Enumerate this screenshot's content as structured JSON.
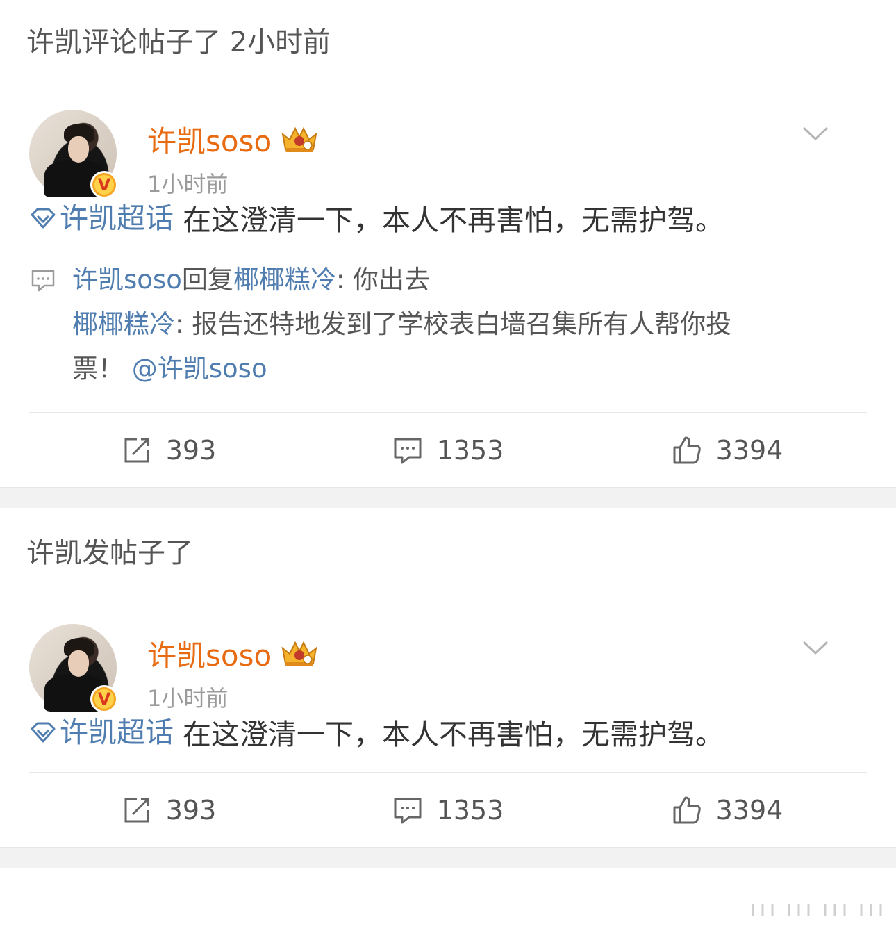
{
  "section1": {
    "header": "许凯评论帖子了 2小时前"
  },
  "post1": {
    "user_name": "许凯soso",
    "time": "1小时前",
    "topic": "许凯超话",
    "content": " 在这澄清一下，本人不再害怕，无需护驾。",
    "reply": {
      "author": "许凯soso",
      "reply_word": "回复",
      "target": "椰椰糕冷",
      "reply_text": ": 你出去",
      "quoted_author": "椰椰糕冷",
      "quoted_text_line1": ": 报告还特地发到了学校表白墙召集所有人帮你投",
      "quoted_text_line2": "票！",
      "mention": "@许凯soso"
    },
    "actions": {
      "repost": "393",
      "comments": "1353",
      "likes": "3394"
    }
  },
  "section2": {
    "header": "许凯发帖子了"
  },
  "post2": {
    "user_name": "许凯soso",
    "time": "1小时前",
    "topic": "许凯超话",
    "content": " 在这澄清一下，本人不再害怕，无需护驾。",
    "actions": {
      "repost": "393",
      "comments": "1353",
      "likes": "3394"
    }
  },
  "icons": [
    "diamond-icon",
    "chevron-down-icon",
    "comment-icon",
    "repost-icon",
    "like-icon",
    "crown-badge-icon",
    "verified-v-icon"
  ],
  "colors": {
    "username": "#e86b11",
    "link": "#507daf",
    "text": "#333333",
    "muted": "#9b9b9b"
  }
}
